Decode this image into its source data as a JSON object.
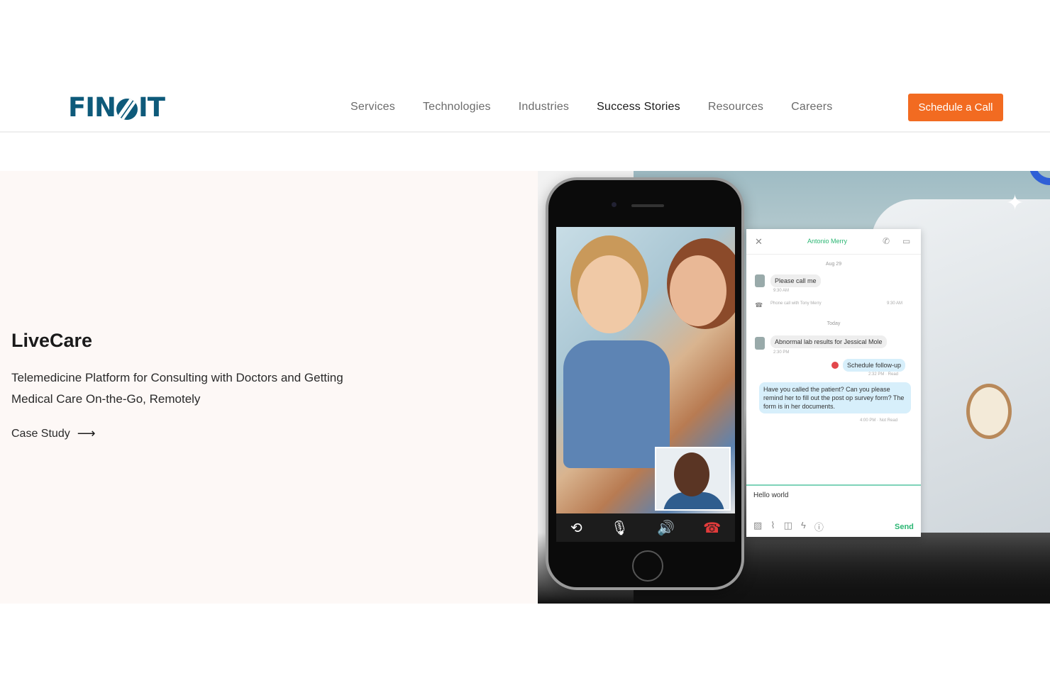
{
  "header": {
    "logo_text": "FIN",
    "logo_text_end": "IT",
    "nav": [
      {
        "label": "Services"
      },
      {
        "label": "Technologies"
      },
      {
        "label": "Industries"
      },
      {
        "label": "Success Stories"
      },
      {
        "label": "Resources"
      },
      {
        "label": "Careers"
      }
    ],
    "cta_label": "Schedule a Call"
  },
  "hero": {
    "title": "LiveCare",
    "subtitle": "Telemedicine Platform for Consulting with Doctors and Getting Medical Care On-the-Go, Remotely",
    "link_label": "Case Study",
    "link_arrow": "⟶"
  },
  "chat": {
    "contact_name": "Antonio Merry",
    "date_1": "Aug 29",
    "msg_1": "Please call me",
    "msg_1_time": "9:30 AM",
    "call_log": "Phone call with Tony Merry",
    "call_log_time": "9:30 AM",
    "date_2": "Today",
    "msg_2": "Abnormal lab results for Jessical Mole",
    "msg_2_time": "2:30 PM",
    "msg_3": "Schedule follow-up",
    "msg_3_time": "2:32 PM · Read",
    "msg_4": "Have you called the patient? Can you please remind her to fill out the post op survey form? The form is in her documents.",
    "msg_4_time": "4:00 PM · Not Read",
    "input_value": "Hello world",
    "send_label": "Send"
  },
  "colors": {
    "brand": "#0e5a7a",
    "cta": "#f26b21",
    "chat_accent": "#2bb673"
  }
}
